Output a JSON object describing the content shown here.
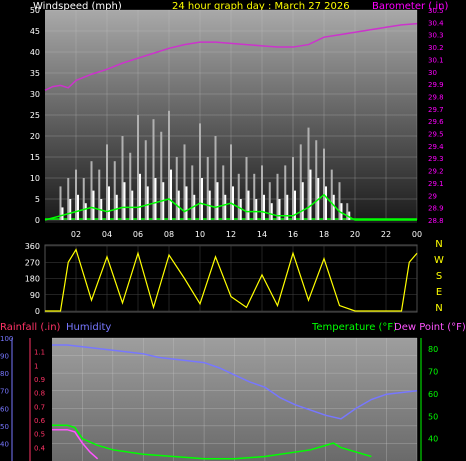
{
  "header": {
    "left_title": "Windspeed (mph)",
    "center_title": "24 hour graph day : March 27 2026",
    "right_title": "Barometer (.in)"
  },
  "colors": {
    "windspeed": "#ffffff",
    "gust": "#b0b0b0",
    "wind_avg": "#00ff00",
    "barometer": "#cc33cc",
    "direction": "#ffff00",
    "humidity": "#7777ff",
    "temperature": "#00ff00",
    "dewpoint": "#ff55ff",
    "rainfall": "#ff3366",
    "title_yellow": "#ffff00",
    "baro_label": "#ff00ff"
  },
  "x_ticks": [
    "02",
    "04",
    "06",
    "08",
    "10",
    "12",
    "14",
    "16",
    "18",
    "20",
    "22",
    "00"
  ],
  "compass": [
    "N",
    "W",
    "S",
    "E",
    "N"
  ],
  "bottom_labels": {
    "rainfall": "Rainfall (.in)",
    "humidity": "Humidity",
    "temperature": "Temperature (°F)",
    "dewpoint": "Dew Point (°F)"
  },
  "chart_data": [
    {
      "type": "line",
      "title": "24 hour graph day : March 27 2026",
      "ylabel": "Windspeed (mph)",
      "ylabel_right": "Barometer (.in)",
      "x_hours": [
        0,
        24
      ],
      "ylim": [
        0,
        50
      ],
      "yticks": [
        0,
        5,
        10,
        15,
        20,
        25,
        30,
        35,
        40,
        45,
        50
      ],
      "ylim_right": [
        28.8,
        30.5
      ],
      "yticks_right": [
        "28.8",
        "28.9",
        "29",
        "29.1",
        "29.2",
        "29.3",
        "29.4",
        "29.5",
        "29.6",
        "29.7",
        "29.8",
        "29.9",
        "30",
        "30.1",
        "30.2",
        "30.3",
        "30.4",
        "30.5"
      ],
      "series": [
        {
          "name": "Barometer",
          "x": [
            0,
            0.5,
            1,
            1.5,
            2,
            3,
            4,
            5,
            6,
            7,
            8,
            9,
            10,
            11,
            12,
            13,
            14,
            15,
            16,
            17,
            18,
            19,
            20,
            21,
            22,
            23,
            24
          ],
          "values": [
            29.85,
            29.88,
            29.89,
            29.87,
            29.93,
            29.98,
            30.02,
            30.07,
            30.11,
            30.15,
            30.19,
            30.22,
            30.24,
            30.24,
            30.23,
            30.22,
            30.21,
            30.2,
            30.2,
            30.22,
            30.28,
            30.3,
            30.32,
            30.34,
            30.36,
            30.38,
            30.39
          ]
        },
        {
          "name": "Windspeed",
          "x": [
            1,
            1.5,
            2,
            2.5,
            3,
            3.5,
            4,
            4.5,
            5,
            5.5,
            6,
            6.5,
            7,
            7.5,
            8,
            8.5,
            9,
            9.5,
            10,
            10.5,
            11,
            11.5,
            12,
            12.5,
            13,
            13.5,
            14,
            14.5,
            15,
            15.5,
            16,
            16.5,
            17,
            17.5,
            18,
            18.5,
            19,
            19.5
          ],
          "values": [
            3,
            5,
            6,
            4,
            7,
            5,
            8,
            6,
            9,
            7,
            11,
            8,
            10,
            9,
            12,
            7,
            8,
            6,
            10,
            7,
            9,
            6,
            8,
            5,
            7,
            5,
            6,
            4,
            5,
            6,
            7,
            9,
            12,
            10,
            8,
            6,
            4,
            2
          ]
        },
        {
          "name": "Gust",
          "x": [
            1,
            1.5,
            2,
            2.5,
            3,
            3.5,
            4,
            4.5,
            5,
            5.5,
            6,
            6.5,
            7,
            7.5,
            8,
            8.5,
            9,
            9.5,
            10,
            10.5,
            11,
            11.5,
            12,
            12.5,
            13,
            13.5,
            14,
            14.5,
            15,
            15.5,
            16,
            16.5,
            17,
            17.5,
            18,
            18.5,
            19,
            19.5
          ],
          "values": [
            8,
            10,
            12,
            10,
            14,
            12,
            18,
            14,
            20,
            16,
            25,
            19,
            24,
            21,
            26,
            15,
            18,
            13,
            23,
            15,
            20,
            13,
            18,
            11,
            15,
            11,
            13,
            9,
            11,
            13,
            15,
            18,
            22,
            19,
            17,
            12,
            9,
            4
          ]
        },
        {
          "name": "Average",
          "x": [
            0,
            1,
            2,
            3,
            4,
            5,
            6,
            7,
            8,
            9,
            10,
            11,
            12,
            13,
            14,
            15,
            16,
            17,
            18,
            19,
            20,
            21,
            22,
            23,
            24
          ],
          "values": [
            0,
            1,
            2,
            3,
            2,
            3,
            3,
            4,
            5,
            2,
            4,
            3,
            4,
            2,
            2,
            1,
            1,
            3,
            6,
            2,
            0,
            0,
            0,
            0,
            0
          ]
        }
      ]
    },
    {
      "type": "line",
      "title": "",
      "ylim": [
        0,
        360
      ],
      "yticks": [
        0,
        90,
        180,
        270,
        360
      ],
      "ylabel_right": "N W S E N",
      "series": [
        {
          "name": "Wind direction",
          "x": [
            0,
            1,
            1.5,
            2,
            3,
            4,
            5,
            6,
            7,
            8,
            9,
            10,
            11,
            12,
            13,
            14,
            15,
            16,
            17,
            18,
            19,
            20,
            21,
            22,
            23,
            23.5,
            24
          ],
          "values": [
            0,
            0,
            270,
            340,
            60,
            300,
            45,
            320,
            20,
            310,
            180,
            40,
            300,
            80,
            20,
            200,
            30,
            320,
            60,
            290,
            30,
            0,
            0,
            0,
            0,
            270,
            320
          ]
        }
      ]
    },
    {
      "type": "line",
      "title": "",
      "ylabel": "Rainfall (.in)",
      "ylabel_left2": "Humidity",
      "ylabel_right": "Temperature (°F)",
      "ylabel_right2": "Dew Point (°F)",
      "ylim_rain": [
        0.3,
        1.2
      ],
      "yticks_rain": [
        "1.1",
        "1",
        "0.9",
        "0.8",
        "0.7",
        "0.6",
        "0.5",
        "0.4"
      ],
      "ylim_humidity": [
        30,
        100
      ],
      "yticks_humidity": [
        40,
        50,
        60,
        70,
        80,
        90,
        100
      ],
      "ylim_temp": [
        30,
        85
      ],
      "yticks_temp": [
        40,
        50,
        60,
        70,
        80
      ],
      "series": [
        {
          "name": "Humidity",
          "x": [
            0,
            1,
            2,
            3,
            4,
            5,
            6,
            7,
            8,
            9,
            10,
            11,
            12,
            13,
            14,
            15,
            16,
            17,
            18,
            19,
            20,
            21,
            22,
            23,
            24
          ],
          "values": [
            96,
            96,
            95,
            94,
            93,
            92,
            91,
            89,
            88,
            87,
            86,
            83,
            79,
            75,
            72,
            66,
            62,
            59,
            56,
            54,
            60,
            65,
            68,
            69,
            70
          ]
        },
        {
          "name": "Temperature",
          "x": [
            0,
            1,
            1.5,
            2,
            3,
            4,
            5,
            6,
            8,
            10,
            12,
            14,
            16,
            17,
            18,
            18.5,
            19,
            20,
            21
          ],
          "values": [
            46,
            46,
            45,
            40,
            37,
            35,
            34,
            33,
            32,
            31,
            31,
            32,
            34,
            35,
            37,
            38,
            36,
            34,
            32
          ]
        },
        {
          "name": "Dew Point",
          "x": [
            0,
            1,
            1.5,
            2,
            2.5,
            3
          ],
          "values": [
            44,
            44,
            43,
            38,
            34,
            31
          ]
        }
      ]
    }
  ]
}
